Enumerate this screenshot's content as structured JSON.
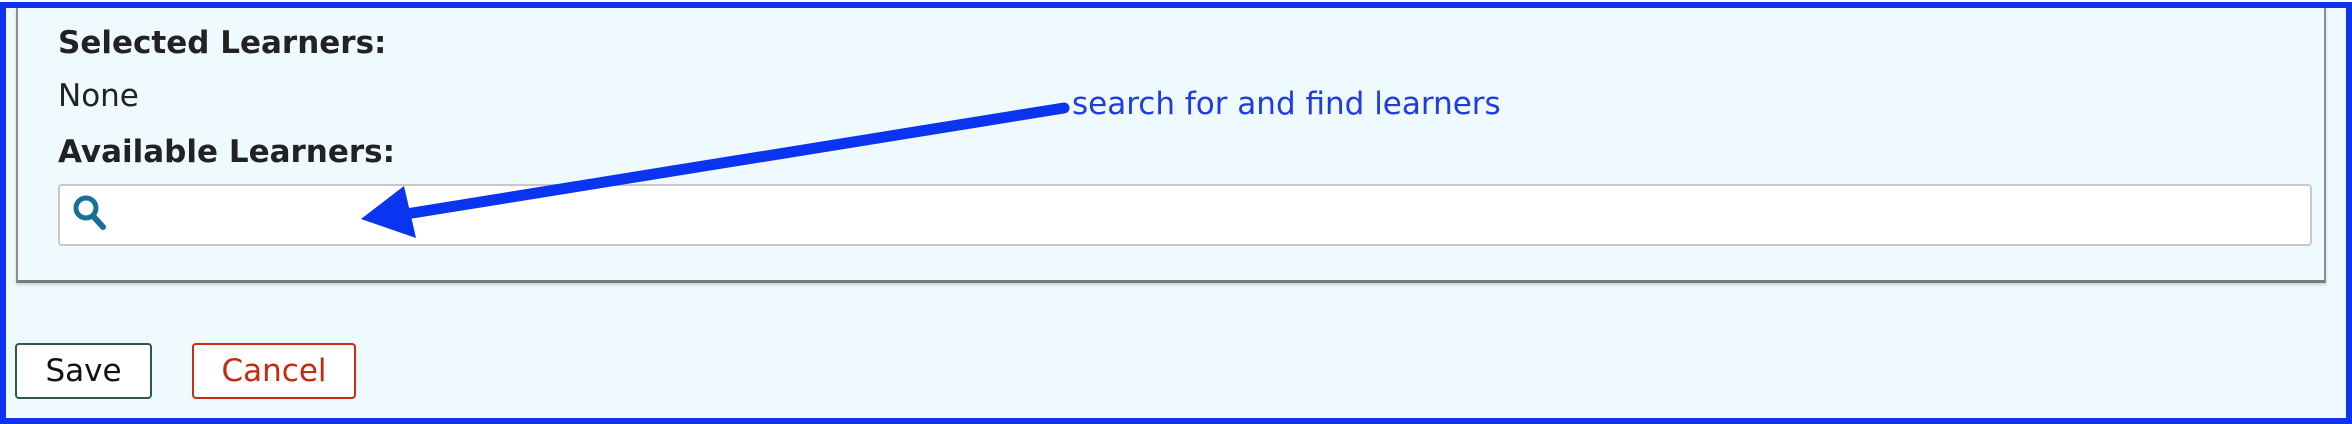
{
  "form": {
    "selected_label": "Selected Learners:",
    "selected_value": "None",
    "available_label": "Available Learners:",
    "search_placeholder": "",
    "search_icon": "search-icon"
  },
  "annotation": {
    "text": "search for and find learners",
    "color": "#1f3be6"
  },
  "buttons": {
    "save_label": "Save",
    "cancel_label": "Cancel"
  },
  "colors": {
    "frame_border": "#0a34f0",
    "panel_background": "#eefafd",
    "cancel_accent": "#cc2a12",
    "save_accent": "#2e5a4a",
    "icon_color": "#1a6f96"
  }
}
